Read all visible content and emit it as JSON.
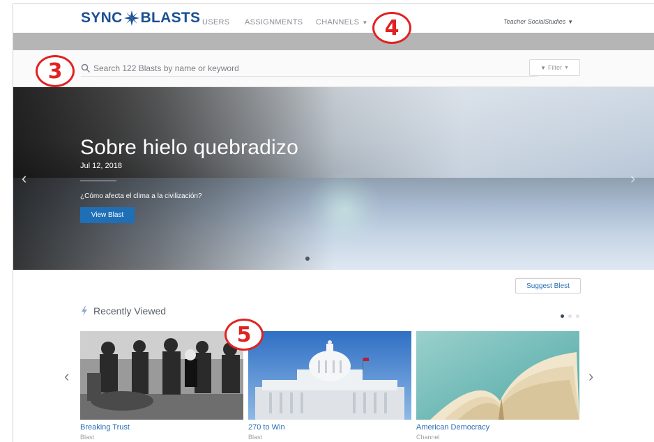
{
  "nav": {
    "logo_left": "SYNC",
    "logo_right": "BLASTS",
    "items": [
      {
        "label": "USERS"
      },
      {
        "label": "ASSIGNMENTS"
      },
      {
        "label": "CHANNELS"
      }
    ],
    "user_label": "Teacher SocialStudies"
  },
  "search": {
    "placeholder": "Search 122 Blasts by name or keyword",
    "filter_label": "Filter"
  },
  "hero": {
    "title": "Sobre hielo quebradizo",
    "date": "Jul 12, 2018",
    "subtitle": "¿Cómo afecta el clima a la civilización?",
    "button_label": "View Blast"
  },
  "recent": {
    "suggest_label": "Suggest Blest",
    "title": "Recently Viewed",
    "cards": [
      {
        "title": "Breaking Trust",
        "type": "Blast",
        "icon": "protest-photo"
      },
      {
        "title": "270 to Win",
        "type": "Blast",
        "icon": "capitol-photo"
      },
      {
        "title": "American Democracy",
        "type": "Channel",
        "icon": "book-photo"
      }
    ]
  },
  "callouts": [
    "3",
    "4",
    "5"
  ],
  "colors": {
    "brand": "#1b4f93",
    "accent_button": "#1f6fb7",
    "link": "#2a6db4",
    "callout": "#e12222"
  }
}
